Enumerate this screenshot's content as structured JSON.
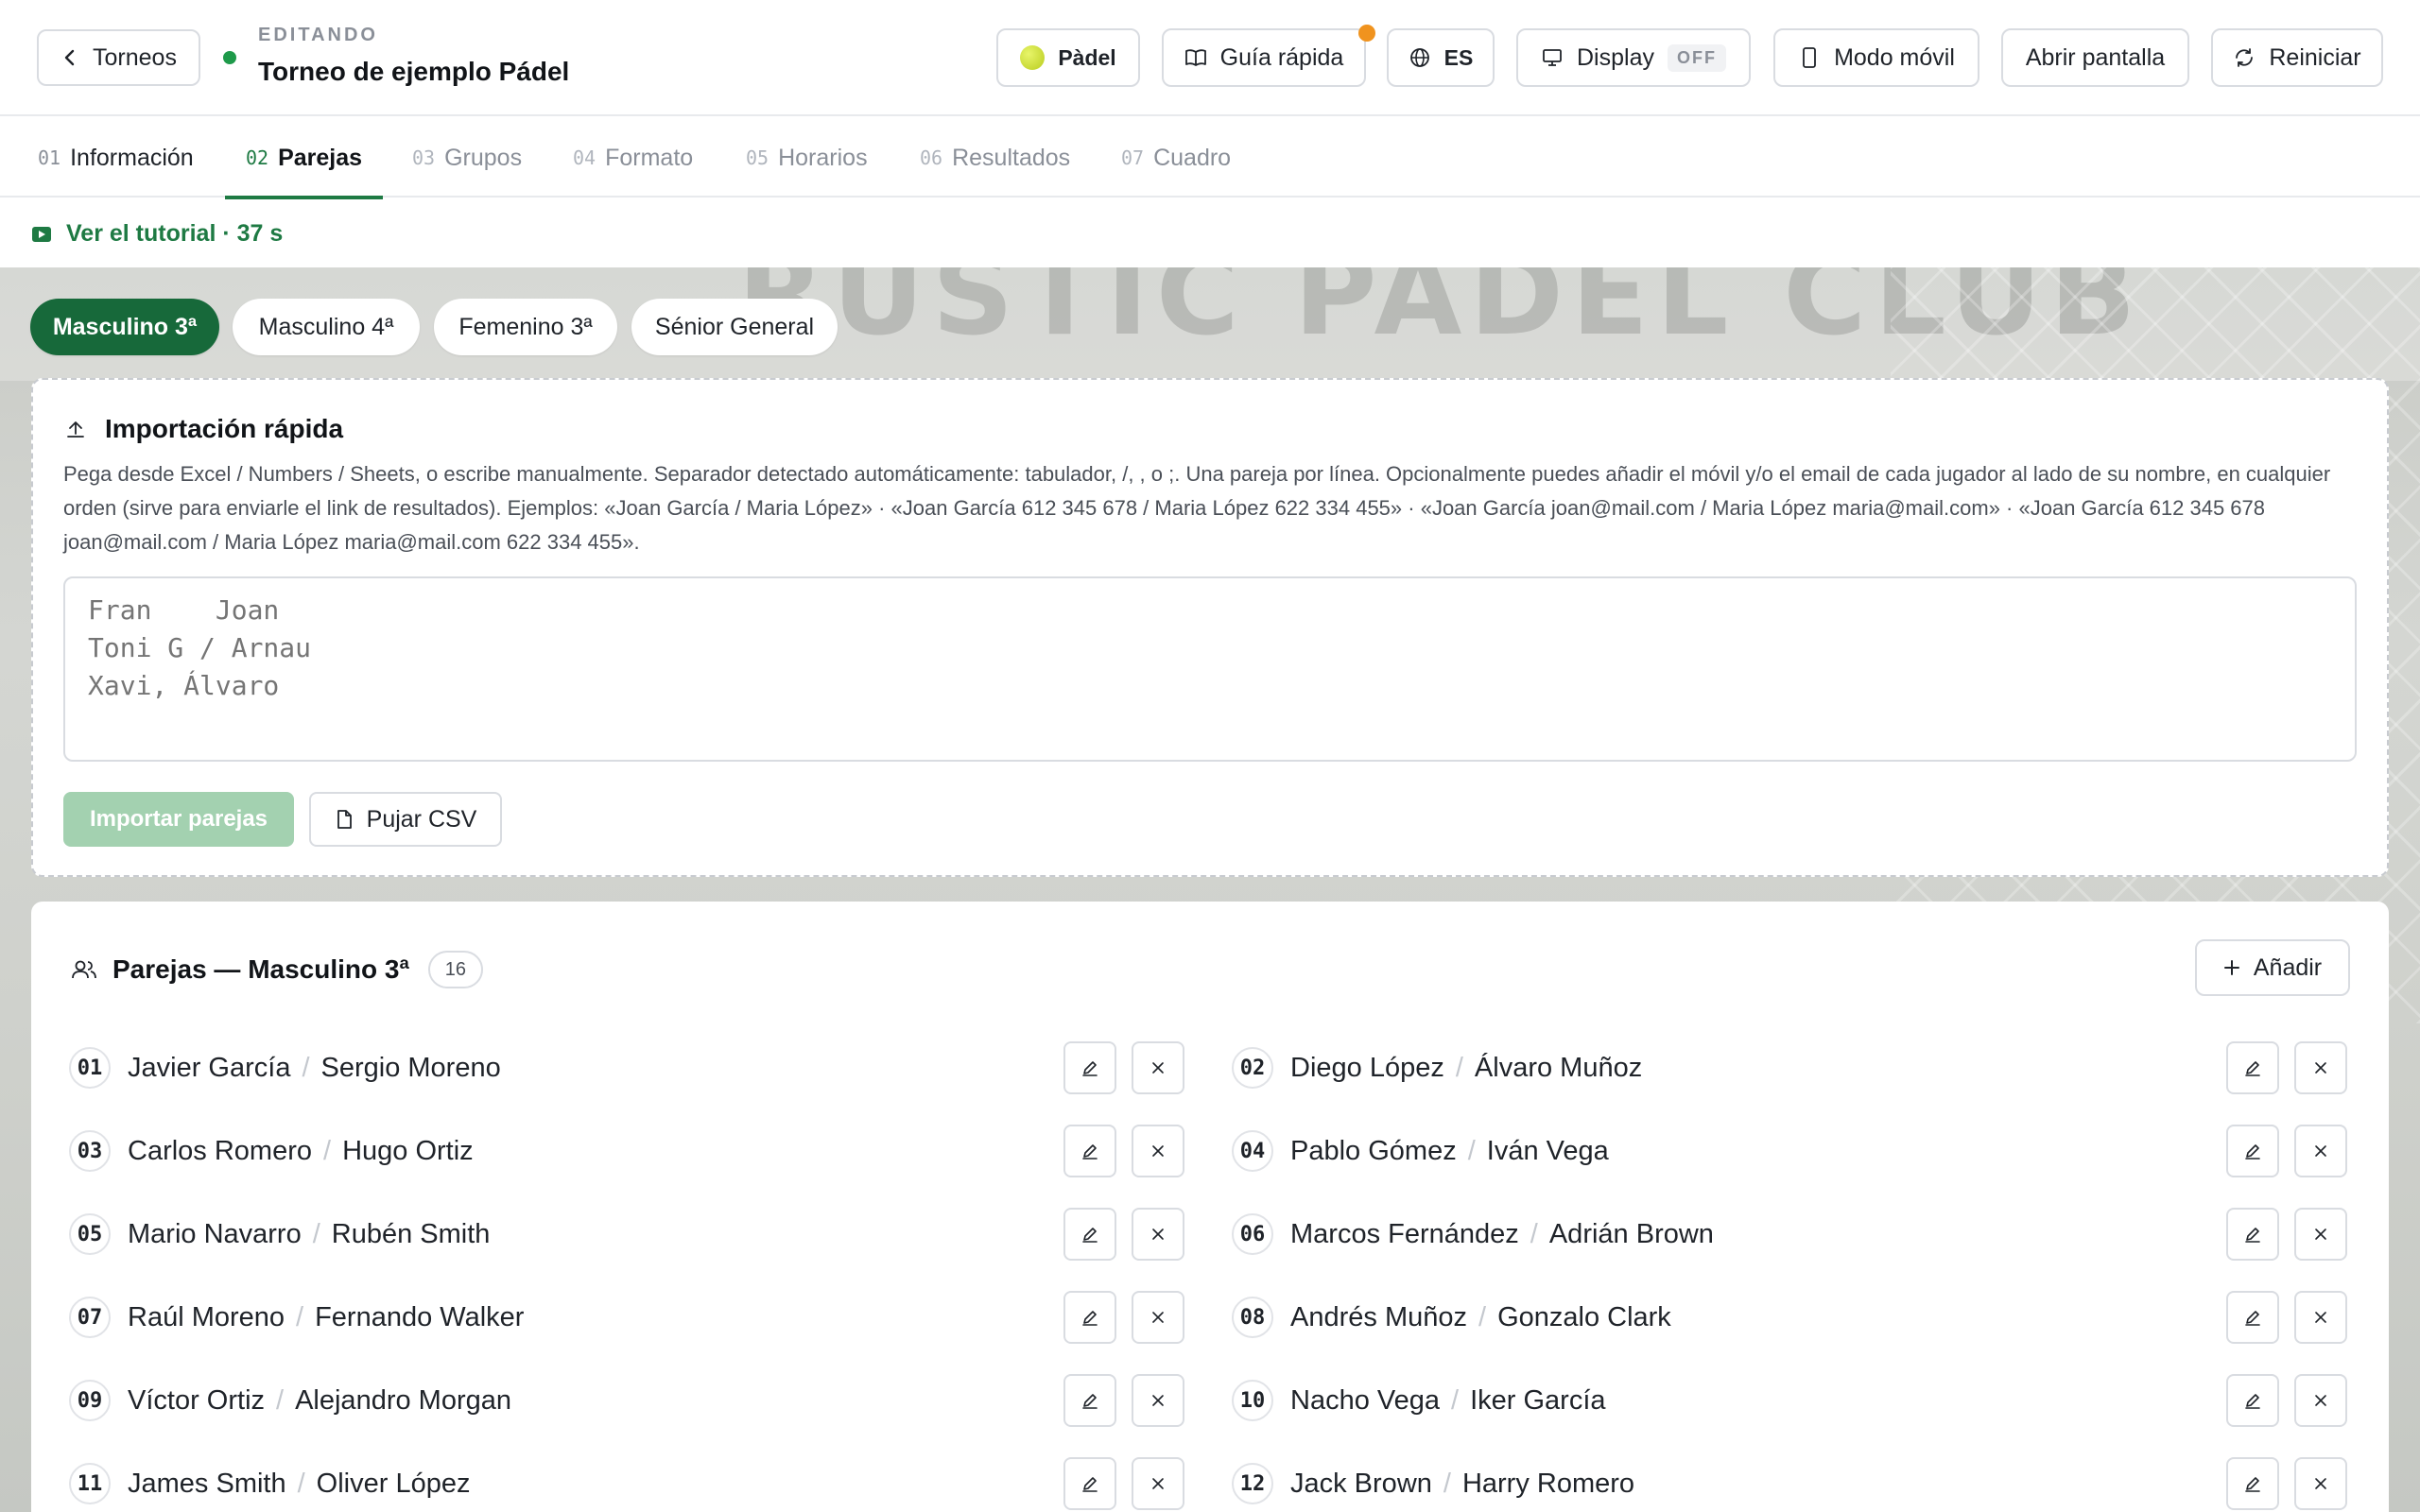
{
  "header": {
    "back_label": "Torneos",
    "editing_label": "EDITANDO",
    "title": "Torneo de ejemplo Pádel",
    "sport_label": "Pàdel",
    "guide_label": "Guía rápida",
    "lang_label": "ES",
    "display_label": "Display",
    "display_state": "OFF",
    "mobile_label": "Modo móvil",
    "open_screen_label": "Abrir pantalla",
    "restart_label": "Reiniciar",
    "colors": {
      "accent": "#1e7a43",
      "notif": "#f0931e",
      "live": "#1e9a4a"
    }
  },
  "steps": [
    {
      "num": "01",
      "label": "Información",
      "state": "done"
    },
    {
      "num": "02",
      "label": "Parejas",
      "state": "active"
    },
    {
      "num": "03",
      "label": "Grupos",
      "state": "pending"
    },
    {
      "num": "04",
      "label": "Formato",
      "state": "pending"
    },
    {
      "num": "05",
      "label": "Horarios",
      "state": "pending"
    },
    {
      "num": "06",
      "label": "Resultados",
      "state": "pending"
    },
    {
      "num": "07",
      "label": "Cuadro",
      "state": "pending"
    }
  ],
  "tutorial": {
    "label": "Ver el tutorial · 37 s"
  },
  "background": {
    "sign_text": "RUSTIC PADEL CLUB"
  },
  "categories": [
    {
      "label": "Masculino 3ª",
      "active": true
    },
    {
      "label": "Masculino 4ª",
      "active": false
    },
    {
      "label": "Femenino 3ª",
      "active": false
    },
    {
      "label": "Sénior General",
      "active": false
    }
  ],
  "import": {
    "title": "Importación rápida",
    "description": "Pega desde Excel / Numbers / Sheets, o escribe manualmente. Separador detectado automáticamente: tabulador, /, , o ;. Una pareja por línea. Opcionalmente puedes añadir el móvil y/o el email de cada jugador al lado de su nombre, en cualquier orden (sirve para enviarle el link de resultados). Ejemplos: «Joan García / Maria López» · «Joan García 612 345 678 / Maria López 622 334 455» · «Joan García joan@mail.com / Maria López maria@mail.com» · «Joan García 612 345 678 joan@mail.com / Maria López maria@mail.com 622 334 455».",
    "placeholder": "Fran    Joan\nToni G / Arnau\nXavi, Álvaro",
    "import_button": "Importar parejas",
    "csv_button": "Pujar CSV"
  },
  "pairs": {
    "title": "Parejas — Masculino 3ª",
    "count": "16",
    "add_button": "Añadir",
    "items": [
      {
        "num": "01",
        "p1": "Javier García",
        "p2": "Sergio Moreno"
      },
      {
        "num": "02",
        "p1": "Diego López",
        "p2": "Álvaro Muñoz"
      },
      {
        "num": "03",
        "p1": "Carlos Romero",
        "p2": "Hugo Ortiz"
      },
      {
        "num": "04",
        "p1": "Pablo Gómez",
        "p2": "Iván Vega"
      },
      {
        "num": "05",
        "p1": "Mario Navarro",
        "p2": "Rubén Smith"
      },
      {
        "num": "06",
        "p1": "Marcos Fernández",
        "p2": "Adrián Brown"
      },
      {
        "num": "07",
        "p1": "Raúl Moreno",
        "p2": "Fernando Walker"
      },
      {
        "num": "08",
        "p1": "Andrés Muñoz",
        "p2": "Gonzalo Clark"
      },
      {
        "num": "09",
        "p1": "Víctor Ortiz",
        "p2": "Alejandro Morgan"
      },
      {
        "num": "10",
        "p1": "Nacho Vega",
        "p2": "Iker García"
      },
      {
        "num": "11",
        "p1": "James Smith",
        "p2": "Oliver López"
      },
      {
        "num": "12",
        "p1": "Jack Brown",
        "p2": "Harry Romero"
      }
    ]
  }
}
